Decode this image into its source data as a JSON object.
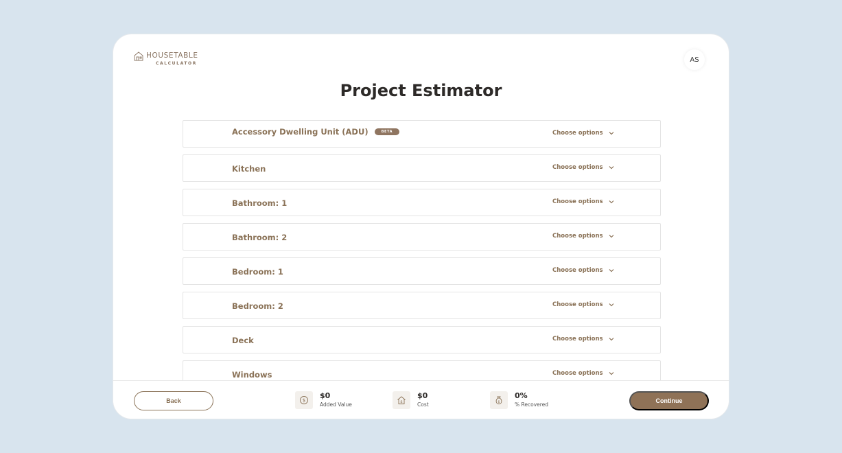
{
  "app": {
    "logo_name": "HOUSETABLE",
    "logo_sub": "CALCULATOR",
    "avatar_initials": "AS"
  },
  "page": {
    "title": "Project Estimator"
  },
  "rows": [
    {
      "label": "Accessory Dwelling Unit (ADU)",
      "badge": "BETA",
      "action": "Choose options"
    },
    {
      "label": "Kitchen",
      "action": "Choose options"
    },
    {
      "label": "Bathroom: 1",
      "action": "Choose options"
    },
    {
      "label": "Bathroom: 2",
      "action": "Choose options"
    },
    {
      "label": "Bedroom: 1",
      "action": "Choose options"
    },
    {
      "label": "Bedroom: 2",
      "action": "Choose options"
    },
    {
      "label": "Deck",
      "action": "Choose options"
    },
    {
      "label": "Windows",
      "action": "Choose options"
    }
  ],
  "footer": {
    "back_label": "Back",
    "continue_label": "Continue",
    "stats": [
      {
        "value": "$0",
        "label": "Added Value",
        "icon": "dollar-coin-icon"
      },
      {
        "value": "$0",
        "label": "Cost",
        "icon": "house-dollar-icon"
      },
      {
        "value": "0%",
        "label": "% Recovered",
        "icon": "money-bag-icon"
      }
    ]
  },
  "colors": {
    "accent": "#8f7257",
    "background": "#d8e4ee",
    "text_dark": "#2d2a28"
  }
}
